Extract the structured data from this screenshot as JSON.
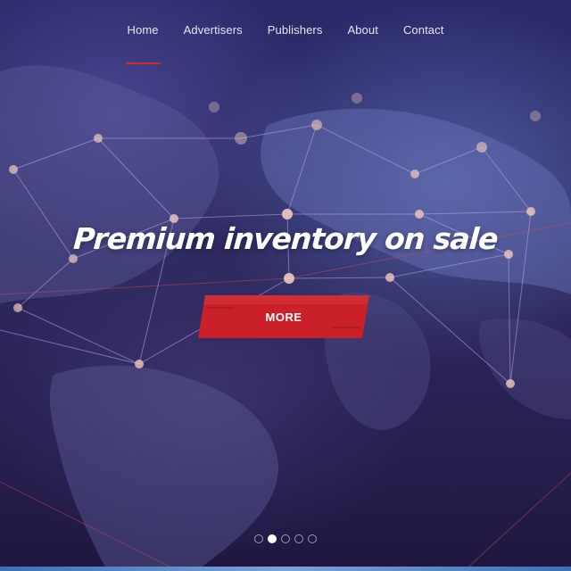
{
  "nav": {
    "items": [
      {
        "label": "Home",
        "active": true
      },
      {
        "label": "Advertisers",
        "active": false
      },
      {
        "label": "Publishers",
        "active": false
      },
      {
        "label": "About",
        "active": false
      },
      {
        "label": "Contact",
        "active": false
      }
    ]
  },
  "hero": {
    "headline": "Premium inventory on sale",
    "button_label": "MORE",
    "background_icon": "world-network-map-icon"
  },
  "slider": {
    "slide_count": 5,
    "active_index": 1
  },
  "colors": {
    "accent": "#d4262b",
    "background": "#2a2a64",
    "text": "#ffffff"
  }
}
